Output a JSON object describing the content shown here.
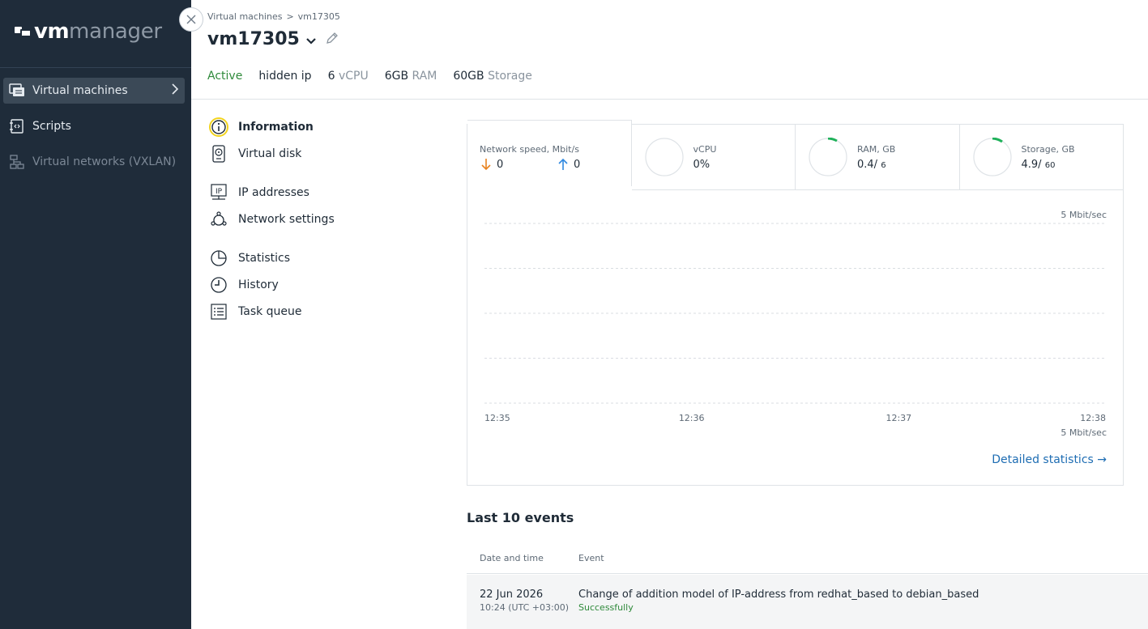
{
  "app": {
    "logo_bold": "vm",
    "logo_light": "manager"
  },
  "sidebar": {
    "items": [
      {
        "label": "Virtual machines",
        "icon": "vm-icon",
        "active": true
      },
      {
        "label": "Scripts",
        "icon": "script-icon"
      },
      {
        "label": "Virtual networks (VXLAN)",
        "icon": "network-icon",
        "disabled": true
      }
    ]
  },
  "breadcrumb": {
    "parent": "Virtual machines",
    "separator": ">",
    "current": "vm17305"
  },
  "vm": {
    "name": "vm17305",
    "status": "Active",
    "ip": "hidden ip",
    "vcpu_value": "6",
    "vcpu_unit": "vCPU",
    "ram_value": "6GB",
    "ram_unit": "RAM",
    "storage_value": "60GB",
    "storage_unit": "Storage"
  },
  "submenu": {
    "items": [
      {
        "label": "Information",
        "icon": "info-icon",
        "active": true
      },
      {
        "label": "Virtual disk",
        "icon": "disk-icon"
      },
      {
        "label": "IP addresses",
        "icon": "ip-icon"
      },
      {
        "label": "Network settings",
        "icon": "network-settings-icon"
      },
      {
        "label": "Statistics",
        "icon": "pie-chart-icon"
      },
      {
        "label": "History",
        "icon": "clock-icon"
      },
      {
        "label": "Task queue",
        "icon": "list-icon"
      }
    ]
  },
  "tabs": {
    "network": {
      "title": "Network speed, Mbit/s",
      "down": "0",
      "up": "0"
    },
    "vcpu": {
      "title": "vCPU",
      "value": "0%"
    },
    "ram": {
      "title": "RAM, GB",
      "used": "0.4/",
      "total": "6"
    },
    "storage": {
      "title": "Storage, GB",
      "used": "4.9/",
      "total": "60"
    }
  },
  "chart_data": {
    "type": "line",
    "x": [
      "12:35",
      "12:36",
      "12:37",
      "12:38"
    ],
    "top_label": "5 Mbit/sec",
    "bottom_label": "5 Mbit/sec",
    "series": [
      {
        "values": [
          null,
          null,
          0.0,
          0.0
        ],
        "start": 12.3733,
        "end": 12.38
      }
    ],
    "ylim": [
      -5,
      5
    ],
    "grid": true
  },
  "colors": {
    "accent": "#1e6db3",
    "success": "#2f8a3b",
    "down_arrow": "#e8821f",
    "up_arrow": "#2f88e0",
    "gauge": "#1fb15a"
  },
  "detail_link": "Detailed statistics →",
  "events": {
    "title": "Last 10 events",
    "headers": {
      "date": "Date and time",
      "event": "Event"
    },
    "rows": [
      {
        "date": "22 Jun 2026",
        "time": "10:24 (UTC +03:00)",
        "event": "Change of addition model of IP-address from redhat_based to debian_based",
        "status": "Successfully"
      }
    ]
  }
}
